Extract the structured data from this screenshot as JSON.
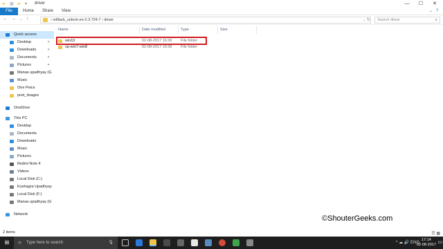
{
  "window": {
    "title": "driver",
    "controls": [
      "—",
      "☐",
      "✕"
    ]
  },
  "ribbon": {
    "file": "File",
    "tabs": [
      "Home",
      "Share",
      "View"
    ]
  },
  "address": {
    "path": "›  miflash_unlock-en-2.3.724.7  ›  driver",
    "search_placeholder": "Search driver"
  },
  "nav": {
    "items": [
      {
        "label": "Quick access",
        "icon": "star-icon",
        "color": "#1e7ad6",
        "pinned": false
      },
      {
        "label": "Desktop",
        "icon": "desktop-icon",
        "color": "#2b8ee0",
        "pinned": true
      },
      {
        "label": "Downloads",
        "icon": "download-icon",
        "color": "#2b8ee0",
        "pinned": true
      },
      {
        "label": "Documents",
        "icon": "documents-icon",
        "color": "#a9b6c6",
        "pinned": true
      },
      {
        "label": "Pictures",
        "icon": "pictures-icon",
        "color": "#8aa7c8",
        "pinned": true
      },
      {
        "label": "Manas upadhyay (G",
        "icon": "drive-icon",
        "color": "#777",
        "pinned": true
      },
      {
        "label": "Music",
        "icon": "music-icon",
        "color": "#5f8fd0",
        "pinned": false
      },
      {
        "label": "One Peice",
        "icon": "folder-icon",
        "color": "#f0c44a",
        "pinned": false
      },
      {
        "label": "post_images",
        "icon": "folder-icon",
        "color": "#f0c44a",
        "pinned": false
      },
      {
        "label": "OneDrive",
        "icon": "cloud-icon",
        "color": "#1e7ad6",
        "pinned": false
      },
      {
        "label": "This PC",
        "icon": "computer-icon",
        "color": "#3b95e0",
        "pinned": false
      },
      {
        "label": "Desktop",
        "icon": "desktop-icon",
        "color": "#2b8ee0",
        "pinned": false
      },
      {
        "label": "Documents",
        "icon": "documents-icon",
        "color": "#a9b6c6",
        "pinned": false
      },
      {
        "label": "Downloads",
        "icon": "download-icon",
        "color": "#2b8ee0",
        "pinned": false
      },
      {
        "label": "Music",
        "icon": "music-icon",
        "color": "#5f8fd0",
        "pinned": false
      },
      {
        "label": "Pictures",
        "icon": "pictures-icon",
        "color": "#8aa7c8",
        "pinned": false
      },
      {
        "label": "Redmi Note 4",
        "icon": "phone-icon",
        "color": "#555",
        "pinned": false
      },
      {
        "label": "Videos",
        "icon": "videos-icon",
        "color": "#6b7f99",
        "pinned": false
      },
      {
        "label": "Local Disk (C:)",
        "icon": "drive-icon",
        "color": "#777",
        "pinned": false
      },
      {
        "label": "Kushagra Upadhyay",
        "icon": "drive-icon",
        "color": "#777",
        "pinned": false
      },
      {
        "label": "Local Disk (F:)",
        "icon": "drive-icon",
        "color": "#777",
        "pinned": false
      },
      {
        "label": "Manas upadhyay (G",
        "icon": "drive-icon",
        "color": "#777",
        "pinned": false
      },
      {
        "label": "Network",
        "icon": "network-icon",
        "color": "#3b95e0",
        "pinned": false
      }
    ]
  },
  "columns": [
    "Name",
    "Date modified",
    "Type",
    "Size"
  ],
  "files": [
    {
      "name": "win10",
      "date": "02-08-2017 16:36",
      "type": "File folder"
    },
    {
      "name": "xp-win7-win8",
      "date": "02-08-2017 16:36",
      "type": "File folder"
    }
  ],
  "status": {
    "count": "2 items"
  },
  "watermark": "©ShouterGeeks.com",
  "taskbar": {
    "search": "Type here to search",
    "time": "17:14",
    "date": "02-08-2017",
    "tray": "^  ☁  🔊  ENG"
  }
}
